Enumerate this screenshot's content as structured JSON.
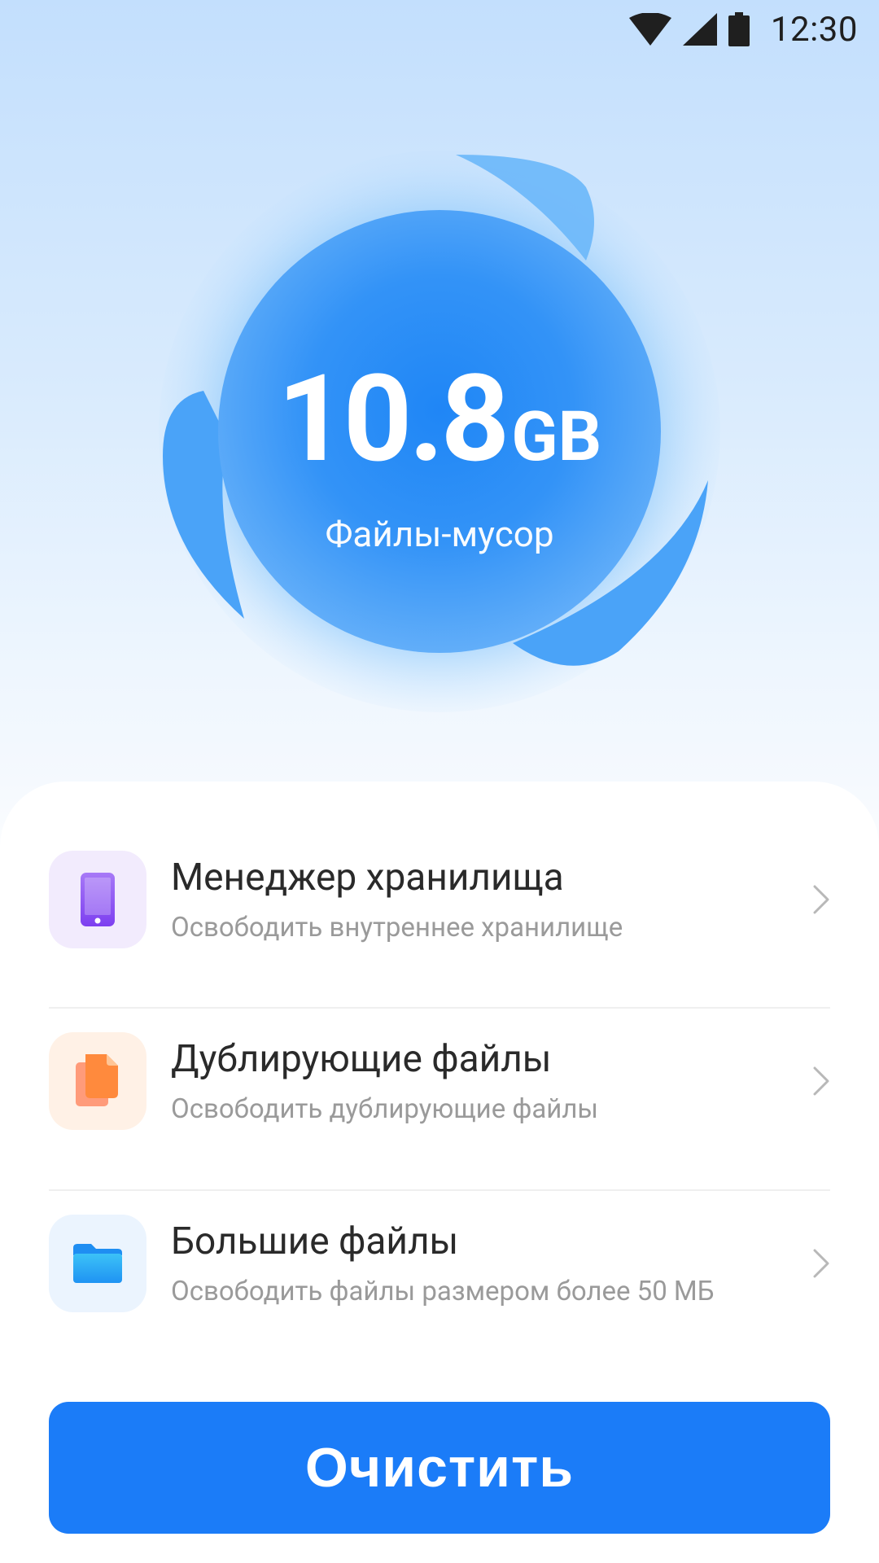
{
  "status_bar": {
    "time": "12:30",
    "icons": [
      "wifi-icon",
      "signal-icon",
      "battery-icon"
    ]
  },
  "summary": {
    "value": "10.8",
    "unit": "GB",
    "label": "Файлы-мусор"
  },
  "items": [
    {
      "title": "Менеджер хранилища",
      "subtitle": "Освободить внутреннее хранилище",
      "icon": "phone-icon",
      "icon_bg": "#f2ebfd",
      "icon_color": "#8a4ff2"
    },
    {
      "title": "Дублирующие файлы",
      "subtitle": "Освободить дублирующие файлы",
      "icon": "duplicate-files-icon",
      "icon_bg": "#fff1e6",
      "icon_color": "#ff8a3d"
    },
    {
      "title": "Большие файлы",
      "subtitle": "Освободить файлы размером более 50 МБ",
      "icon": "folder-icon",
      "icon_bg": "#ebf4fe",
      "icon_color": "#2aa3f5"
    }
  ],
  "action": {
    "label": "Очистить"
  },
  "colors": {
    "accent": "#1b7cf8",
    "bubble": "#3a9bf7"
  }
}
